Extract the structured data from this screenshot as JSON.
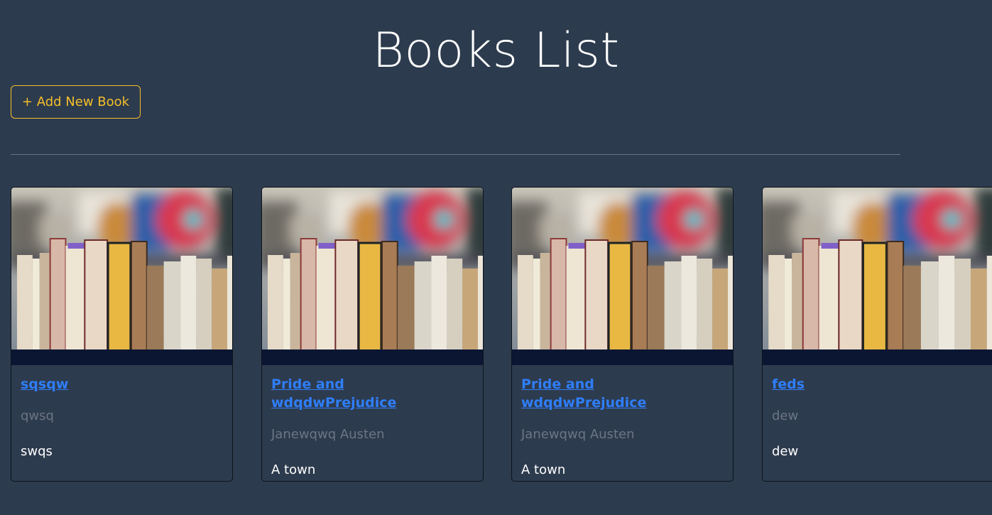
{
  "header": {
    "title": "Books List",
    "add_button_label": "+ Add New Book"
  },
  "colors": {
    "background": "#2d3b4e",
    "accent": "#f4bf2a",
    "link": "#2f7ef8",
    "muted": "#6b7584"
  },
  "books": [
    {
      "title": "sqsqw",
      "author": "qwsq",
      "description": "swqs",
      "image": "bookshelf-photo"
    },
    {
      "title": "Pride and wdqdwPrejudice",
      "author": "Janewqwq Austen",
      "description": "A town wwddwqwdqwqdwqhere lived",
      "image": "bookshelf-photo"
    },
    {
      "title": "Pride and wdqdwPrejudice",
      "author": "Janewqwq Austen",
      "description": "A town wwddwqwdqwqdwqhere lived",
      "image": "bookshelf-photo"
    },
    {
      "title": "feds",
      "author": "dew",
      "description": "dew",
      "image": "bookshelf-photo"
    }
  ]
}
